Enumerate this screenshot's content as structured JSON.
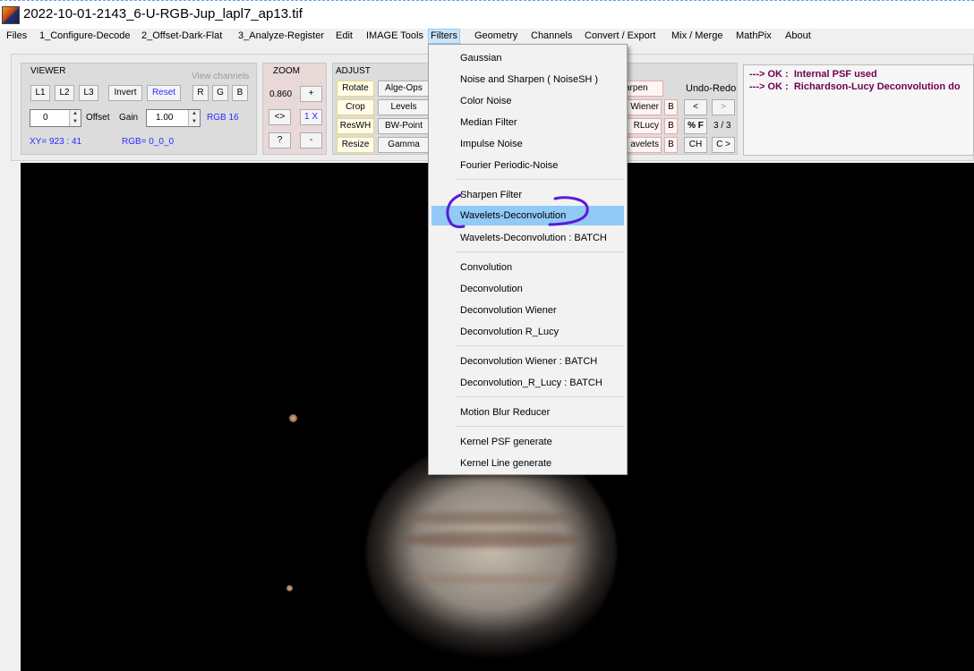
{
  "window": {
    "title": "2022-10-01-2143_6-U-RGB-Jup_lapl7_ap13.tif"
  },
  "menubar": {
    "items": [
      "Files",
      "1_Configure-Decode",
      "2_Offset-Dark-Flat",
      "3_Analyze-Register",
      "Edit",
      "IMAGE Tools",
      "Filters",
      "Geometry",
      "Channels",
      "Convert / Export",
      "Mix / Merge",
      "MathPix",
      "About"
    ],
    "active": "Filters"
  },
  "viewer": {
    "title": "VIEWER",
    "view_channels_label": "View channels",
    "buttons": {
      "l1": "L1",
      "l2": "L2",
      "l3": "L3",
      "invert": "Invert",
      "reset": "Reset",
      "r": "R",
      "g": "G",
      "b": "B"
    },
    "offset_value": "0",
    "offset_label": "Offset",
    "gain_label": "Gain",
    "gain_value": "1.00",
    "rgb_mode": "RGB 16",
    "xy": "XY=  923 : 41",
    "rgb": "RGB=  0_0_0"
  },
  "zoom": {
    "title": "ZOOM",
    "value": "0.860",
    "plus": "+",
    "fit": "<>",
    "one_x": "1 X",
    "help": "?",
    "minus": "-"
  },
  "adjust": {
    "title": "ADJUST",
    "buttons": {
      "rotate": "Rotate",
      "alge_ops": "Alge-Ops",
      "crop": "Crop",
      "levels": "Levels",
      "reswh": "ResWH",
      "bw_point": "BW-Point",
      "resize": "Resize",
      "gamma": "Gamma"
    }
  },
  "filters_panel": {
    "sharpen": "arpen",
    "wiener": "Wiener",
    "rlucy": "RLucy",
    "wavelets": "avelets",
    "b": "B"
  },
  "undo_redo": {
    "title": "Undo-Redo",
    "undo": "<",
    "redo": ">",
    "percent": "% F",
    "count": "3 / 3",
    "ch": "CH",
    "c_redo": "C >"
  },
  "messages": [
    {
      "prefix": "---> OK :",
      "text": "Internal PSF used"
    },
    {
      "prefix": "---> OK :",
      "text": "Richardson-Lucy Deconvolution do"
    }
  ],
  "filters_menu": {
    "groups": [
      [
        "Gaussian",
        "Noise and Sharpen  ( NoiseSH )",
        "Color Noise",
        "Median Filter",
        "Impulse Noise",
        "Fourier Periodic-Noise"
      ],
      [
        "Sharpen Filter",
        "Wavelets-Deconvolution",
        "Wavelets-Deconvolution : BATCH"
      ],
      [
        "Convolution",
        "Deconvolution",
        "Deconvolution Wiener",
        "Deconvolution R_Lucy"
      ],
      [
        "Deconvolution Wiener : BATCH",
        "Deconvolution_R_Lucy : BATCH"
      ],
      [
        "Motion Blur Reducer"
      ],
      [
        "Kernel PSF generate",
        "Kernel Line generate"
      ]
    ],
    "highlighted": "Wavelets-Deconvolution"
  },
  "colors": {
    "highlight": "#91c9f7",
    "annotation_stroke": "#5a1ad8",
    "message_text": "#700050",
    "blue_text": "#2a2aff"
  }
}
